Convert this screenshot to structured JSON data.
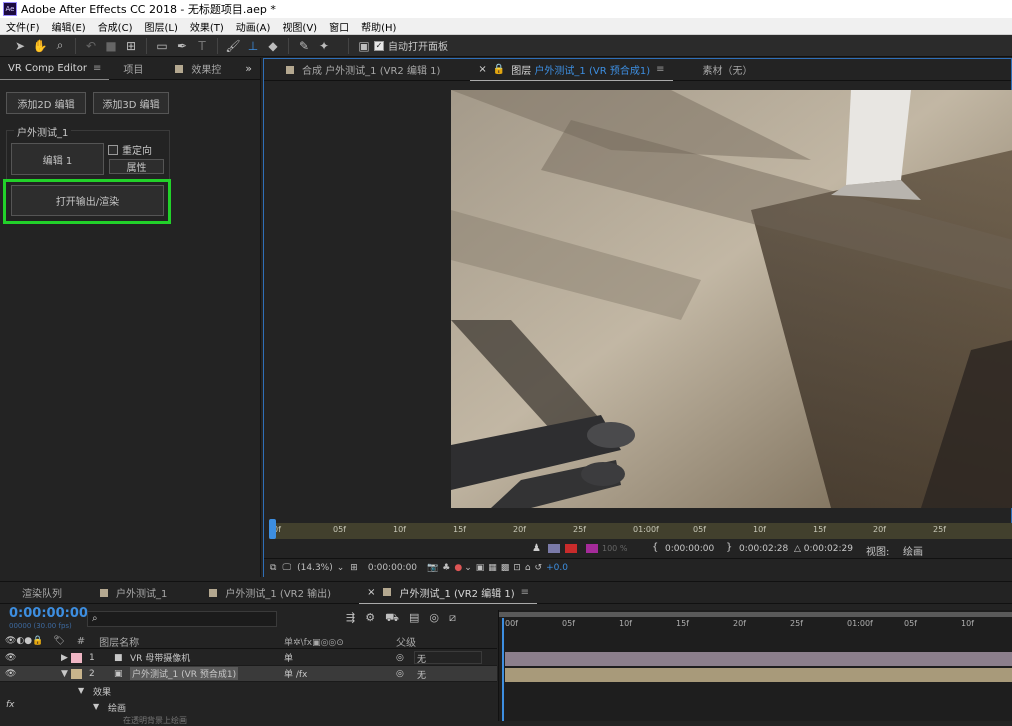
{
  "window": {
    "title": "Adobe After Effects CC 2018 - 无标题项目.aep *",
    "app_icon": "Ae"
  },
  "menu": [
    "文件(F)",
    "编辑(E)",
    "合成(C)",
    "图层(L)",
    "效果(T)",
    "动画(A)",
    "视图(V)",
    "窗口",
    "帮助(H)"
  ],
  "toolbar": {
    "auto_open_label": "自动打开面板",
    "auto_open_checked": true
  },
  "left_panel": {
    "tabs": [
      "VR Comp Editor",
      "项目",
      "效果控"
    ],
    "add_2d": "添加2D 编辑",
    "add_3d": "添加3D 编辑",
    "group_title": "户外测试_1",
    "edit_1": "编辑 1",
    "reorient_label": "重定向",
    "properties": "属性",
    "open_output": "打开输出/渲染",
    "highlight_color": "#22d12a"
  },
  "viewer": {
    "tabs": [
      {
        "prefix": "合成",
        "name": "户外测试_1 (VR2 编辑 1)"
      },
      {
        "prefix": "图层",
        "name": "户外测试_1 (VR 预合成1)"
      },
      {
        "prefix": "素材",
        "name": "（无）"
      }
    ],
    "ruler_ticks": [
      "0f",
      "05f",
      "10f",
      "15f",
      "20f",
      "25f",
      "01:00f",
      "05f",
      "10f",
      "15f",
      "20f",
      "25f"
    ],
    "in_point": "0:00:00:00",
    "out_point": "0:00:02:28",
    "duration": "△ 0:00:02:29",
    "view_label": "视图:",
    "view_mode": "绘画",
    "opacity_value": "100 %",
    "zoom": "(14.3%)",
    "current_time": "0:00:00:00",
    "exposure": "+0.0"
  },
  "timeline": {
    "tabs": [
      "渲染队列",
      "户外测试_1",
      "户外测试_1 (VR2 输出)",
      "户外测试_1 (VR2 编辑 1)"
    ],
    "current_time": "0:00:00:00",
    "fps": "00000 (30.00 fps)",
    "search_placeholder": "",
    "col_num": "#",
    "col_name": "图层名称",
    "col_switches": "单✲\\fx▣◎◎⊙",
    "col_parent": "父级",
    "ticks": [
      "00f",
      "05f",
      "10f",
      "15f",
      "20f",
      "25f",
      "01:00f",
      "05f",
      "10f"
    ],
    "layers": [
      {
        "num": "1",
        "name": "VR 母带摄像机",
        "color": "#f0b6c4",
        "switch": "单",
        "parent": "无",
        "bar_color": "#8c7f8c"
      },
      {
        "num": "2",
        "name": "户外测试_1 (VR 预合成1)",
        "color": "#c8b48c",
        "switch": "单  /fx",
        "parent": "无",
        "bar_color": "#a89a7a"
      }
    ],
    "sub_items": [
      "效果",
      "绘画",
      "在透明背景上绘画"
    ],
    "fx_label": "fx"
  }
}
